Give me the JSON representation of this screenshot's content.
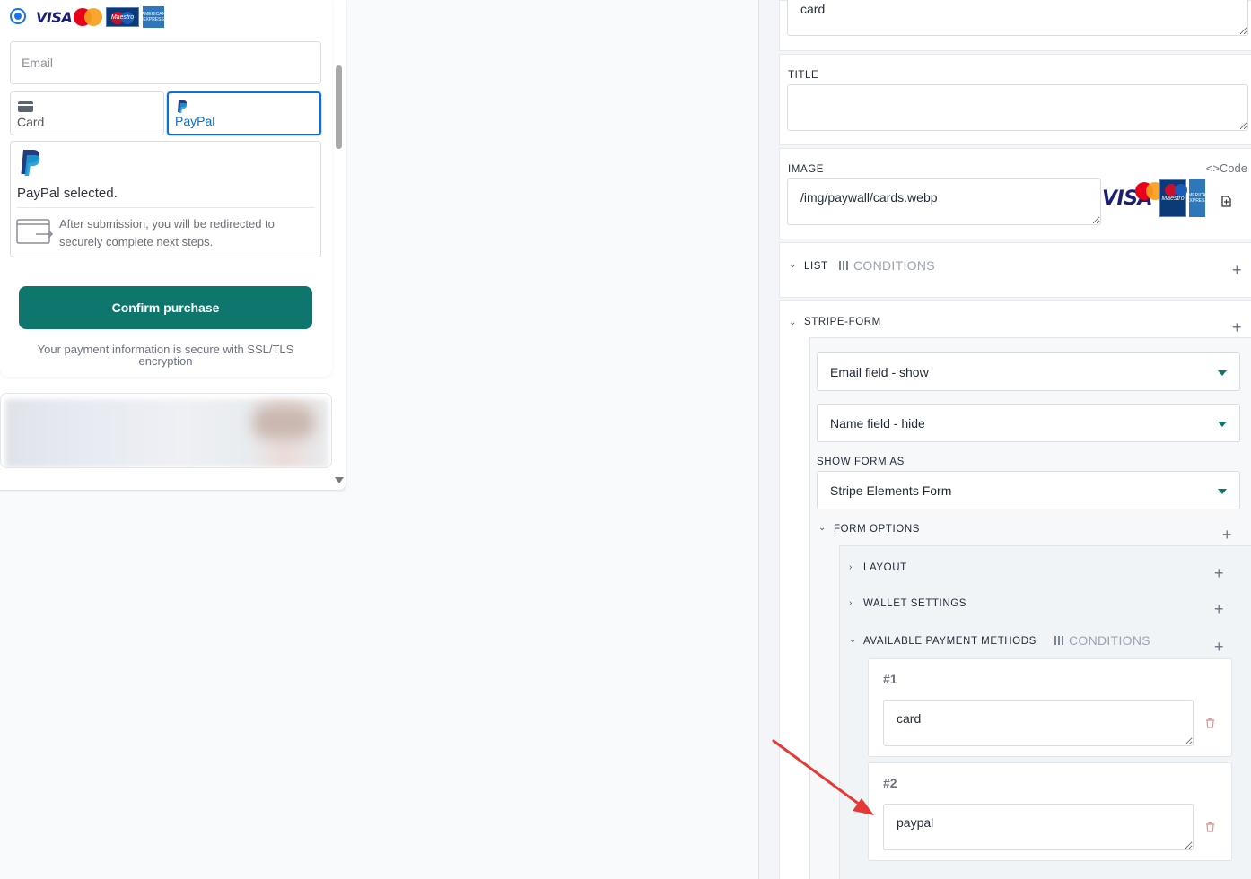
{
  "preview": {
    "card_brands": {
      "visa": "VISA",
      "maestro": "Maestro",
      "amex": "AMERICAN EXPRESS"
    },
    "email_placeholder": "Email",
    "tabs": {
      "card": "Card",
      "paypal": "PayPal"
    },
    "paypal_selected": "PayPal selected.",
    "redirect_text": "After submission, you will be redirected to securely complete next steps.",
    "confirm_label": "Confirm purchase",
    "secure_text": "Your payment information is secure with SSL/TLS encryption"
  },
  "editor": {
    "top_value": "card",
    "title_label": "TITLE",
    "title_value": "",
    "image_label": "IMAGE",
    "code_link": "<>Code",
    "image_value": "/img/paywall/cards.webp",
    "list_label": "LIST",
    "conditions_label": "CONDITIONS",
    "stripe_label": "STRIPE-FORM",
    "email_field_select": "Email field - show",
    "name_field_select": "Name field - hide",
    "show_form_as_label": "SHOW FORM AS",
    "show_form_as_select": "Stripe Elements Form",
    "form_options_label": "FORM OPTIONS",
    "layout_label": "LAYOUT",
    "wallet_label": "WALLET SETTINGS",
    "apm_label": "AVAILABLE PAYMENT METHODS",
    "items": [
      {
        "num": "#1",
        "value": "card"
      },
      {
        "num": "#2",
        "value": "paypal"
      }
    ]
  },
  "colors": {
    "accent": "#0f766e",
    "link_blue": "#0570de",
    "annotation_arrow": "#e53935"
  }
}
